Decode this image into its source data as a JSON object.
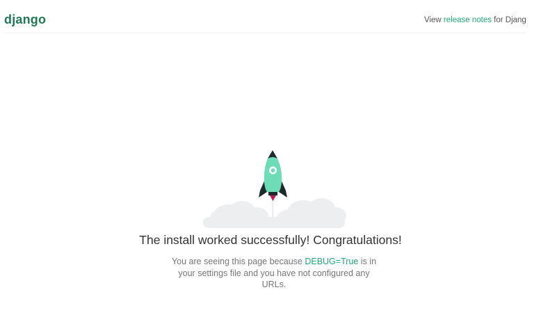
{
  "header": {
    "logo": "django",
    "release_prefix": "View ",
    "release_link": "release notes",
    "release_suffix": " for Django"
  },
  "main": {
    "headline": "The install worked successfully! Congratulations!",
    "sub_prefix": "You are seeing this page because ",
    "sub_code": "DEBUG=True",
    "sub_suffix": " is in your settings file and you have not configured any URLs."
  },
  "icons": {
    "rocket": "rocket-icon",
    "clouds": "cloud-icon"
  },
  "colors": {
    "brand": "#1f7a55",
    "link": "#20aa76",
    "rocket_body": "#6fdcb8",
    "rocket_dark": "#1d2a2e",
    "flame": "#c2185b",
    "cloud": "#eceef0"
  }
}
